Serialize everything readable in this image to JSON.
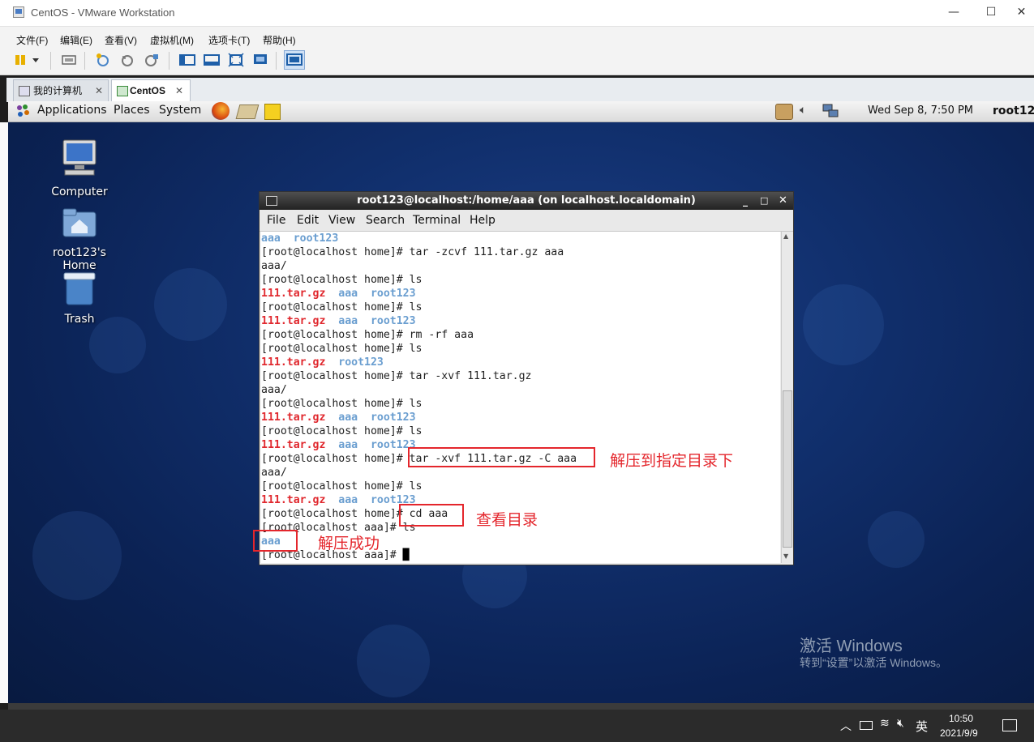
{
  "window": {
    "title": "CentOS - VMware Workstation",
    "min": "—",
    "max": "☐",
    "close": "✕"
  },
  "menu": [
    "文件(F)",
    "编辑(E)",
    "查看(V)",
    "虚拟机(M)",
    "选项卡(T)",
    "帮助(H)"
  ],
  "tabs": [
    {
      "label": "我的计算机",
      "close": "✕"
    },
    {
      "label": "CentOS",
      "close": "✕"
    }
  ],
  "guest_panel": {
    "menus": [
      "Applications",
      "Places",
      "System"
    ],
    "datetime": "Wed Sep  8,  7:50 PM",
    "user": "root12"
  },
  "desktop_icons": [
    {
      "label": "Computer"
    },
    {
      "label": "root123's Home"
    },
    {
      "label": "Trash"
    }
  ],
  "terminal": {
    "title": "root123@localhost:/home/aaa (on localhost.localdomain)",
    "menu": [
      "File",
      "Edit",
      "View",
      "Search",
      "Terminal",
      "Help"
    ],
    "lines": [
      [
        {
          "t": "aaa  root123",
          "c": "blue"
        }
      ],
      [
        {
          "t": "[root@localhost home]# tar -zcvf 111.tar.gz aaa",
          "c": ""
        }
      ],
      [
        {
          "t": "aaa/",
          "c": ""
        }
      ],
      [
        {
          "t": "[root@localhost home]# ls",
          "c": ""
        }
      ],
      [
        {
          "t": "111.tar.gz",
          "c": "red"
        },
        {
          "t": "  aaa  root123",
          "c": "blue"
        }
      ],
      [
        {
          "t": "[root@localhost home]# ls",
          "c": ""
        }
      ],
      [
        {
          "t": "111.tar.gz",
          "c": "red"
        },
        {
          "t": "  aaa  root123",
          "c": "blue"
        }
      ],
      [
        {
          "t": "[root@localhost home]# rm -rf aaa",
          "c": ""
        }
      ],
      [
        {
          "t": "[root@localhost home]# ls",
          "c": ""
        }
      ],
      [
        {
          "t": "111.tar.gz",
          "c": "red"
        },
        {
          "t": "  root123",
          "c": "blue"
        }
      ],
      [
        {
          "t": "[root@localhost home]# tar -xvf 111.tar.gz",
          "c": ""
        }
      ],
      [
        {
          "t": "aaa/",
          "c": ""
        }
      ],
      [
        {
          "t": "[root@localhost home]# ls",
          "c": ""
        }
      ],
      [
        {
          "t": "111.tar.gz",
          "c": "red"
        },
        {
          "t": "  aaa  root123",
          "c": "blue"
        }
      ],
      [
        {
          "t": "[root@localhost home]# ls",
          "c": ""
        }
      ],
      [
        {
          "t": "111.tar.gz",
          "c": "red"
        },
        {
          "t": "  aaa  root123",
          "c": "blue"
        }
      ],
      [
        {
          "t": "[root@localhost home]# tar -xvf 111.tar.gz -C aaa",
          "c": ""
        }
      ],
      [
        {
          "t": "aaa/",
          "c": ""
        }
      ],
      [
        {
          "t": "[root@localhost home]# ls",
          "c": ""
        }
      ],
      [
        {
          "t": "111.tar.gz",
          "c": "red"
        },
        {
          "t": "  aaa  root123",
          "c": "blue"
        }
      ],
      [
        {
          "t": "[root@localhost home]# cd aaa",
          "c": ""
        }
      ],
      [
        {
          "t": "[root@localhost aaa]# ls",
          "c": ""
        }
      ],
      [
        {
          "t": "aaa",
          "c": "blue"
        }
      ],
      [
        {
          "t": "[root@localhost aaa]# ",
          "c": ""
        },
        {
          "t": "█",
          "c": "cursor"
        }
      ]
    ]
  },
  "annotations": {
    "a1": "解压到指定目录下",
    "a2": "查看目录",
    "a3": "解压成功"
  },
  "watermark": {
    "line1": "激活 Windows",
    "line2": "转到“设置”以激活 Windows。"
  },
  "taskbar": {
    "ime": "英",
    "time": "10:50",
    "date": "2021/9/9"
  }
}
